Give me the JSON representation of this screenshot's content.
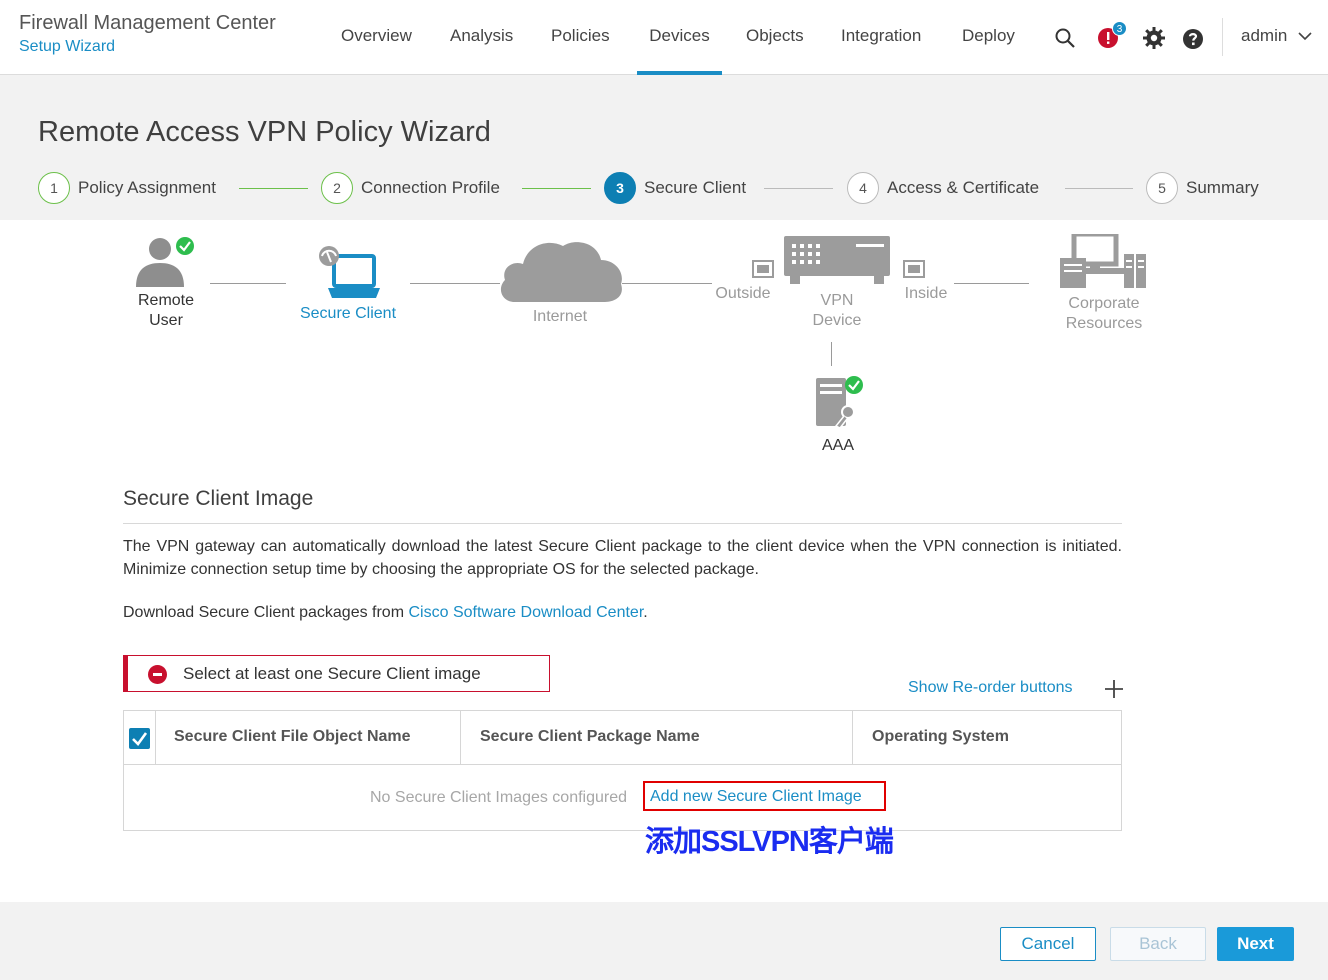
{
  "header": {
    "app_title": "Firewall Management Center",
    "app_subtitle": "Setup Wizard",
    "nav": [
      "Overview",
      "Analysis",
      "Policies",
      "Devices",
      "Objects",
      "Integration",
      "Deploy"
    ],
    "active_nav": "Devices",
    "alert_count": "3",
    "user": "admin",
    "icons": [
      "search-icon",
      "alert-icon",
      "gear-icon",
      "help-icon",
      "chevron-down-icon"
    ]
  },
  "wizard": {
    "title": "Remote Access VPN Policy Wizard",
    "steps": [
      {
        "num": "1",
        "label": "Policy Assignment",
        "state": "done"
      },
      {
        "num": "2",
        "label": "Connection Profile",
        "state": "done"
      },
      {
        "num": "3",
        "label": "Secure Client",
        "state": "current"
      },
      {
        "num": "4",
        "label": "Access & Certificate",
        "state": "pending"
      },
      {
        "num": "5",
        "label": "Summary",
        "state": "pending"
      }
    ]
  },
  "diagram": {
    "remote_user": "Remote\nUser",
    "secure_client": "Secure Client",
    "internet": "Internet",
    "outside": "Outside",
    "vpn_device": "VPN\nDevice",
    "inside": "Inside",
    "corporate": "Corporate\nResources",
    "aaa": "AAA"
  },
  "section": {
    "title": "Secure Client Image",
    "description": "The VPN gateway can automatically download the latest Secure Client package to the client device when the VPN connection is initiated. Minimize connection setup time by choosing the appropriate OS for the selected package.",
    "download_prefix": "Download Secure Client packages from ",
    "download_link": "Cisco Software Download Center",
    "download_suffix": ".",
    "error": "Select at least one Secure Client image",
    "reorder_link": "Show Re-order buttons",
    "columns": [
      "Secure Client File Object Name",
      "Secure Client Package Name",
      "Operating System"
    ],
    "empty_text": "No Secure Client Images configured",
    "add_link": "Add new Secure Client Image",
    "annotation": "添加SSLVPN客户端"
  },
  "footer": {
    "cancel": "Cancel",
    "back": "Back",
    "next": "Next"
  },
  "colors": {
    "accent": "#1a8dc5",
    "error": "#c8102e",
    "success": "#6cc04a",
    "annotation_box": "#e00000",
    "annotation_text": "#1a2cf0"
  }
}
